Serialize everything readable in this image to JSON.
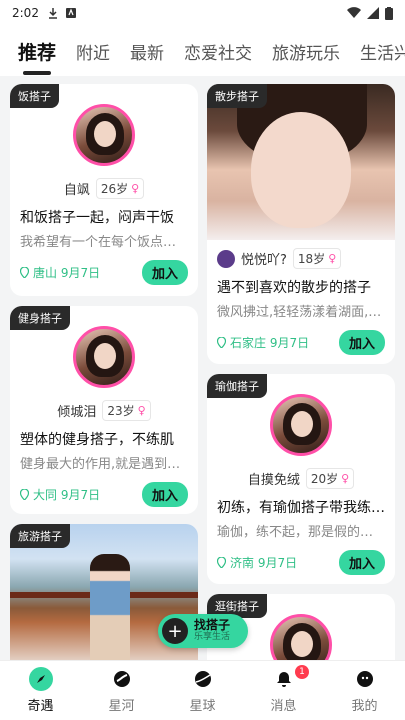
{
  "status": {
    "time": "2:02"
  },
  "tabs": [
    {
      "label": "推荐"
    },
    {
      "label": "附近"
    },
    {
      "label": "最新"
    },
    {
      "label": "恋爱社交"
    },
    {
      "label": "旅游玩乐"
    },
    {
      "label": "生活兴趣"
    }
  ],
  "cards": {
    "c1": {
      "tag": "饭搭子",
      "name": "自飒",
      "age": "26岁",
      "title": "和饭搭子一起，闷声干饭",
      "desc": "我希望有一个在每个饭点…",
      "location": "唐山 9月7日",
      "join": "加入"
    },
    "c2": {
      "tag": "散步搭子",
      "name": "悦悦吖?",
      "age": "18岁",
      "title": "遇不到喜欢的散步的搭子",
      "desc": "微风拂过,轻轻荡漾着湖面,…",
      "location": "石家庄 9月7日",
      "join": "加入"
    },
    "c3": {
      "tag": "健身搭子",
      "name": "倾城泪",
      "age": "23岁",
      "title": "塑体的健身搭子，不练肌",
      "desc": "健身最大的作用,就是遇到…",
      "location": "大同 9月7日",
      "join": "加入"
    },
    "c4": {
      "tag": "瑜伽搭子",
      "name": "自摸免绒",
      "age": "20岁",
      "title": "初练，有瑜伽搭子带我练…",
      "desc": "瑜伽，练不起，那是假的…",
      "location": "济南 9月7日",
      "join": "加入"
    },
    "c5": {
      "tag": "旅游搭子"
    },
    "c6": {
      "tag": "逛街搭子"
    }
  },
  "fab": {
    "title": "找搭子",
    "subtitle": "乐享生活"
  },
  "nav": [
    {
      "label": "奇遇",
      "icon": "compass-icon"
    },
    {
      "label": "星河",
      "icon": "galaxy-icon"
    },
    {
      "label": "星球",
      "icon": "planet-icon"
    },
    {
      "label": "消息",
      "icon": "bell-icon",
      "badge": "1"
    },
    {
      "label": "我的",
      "icon": "profile-icon"
    }
  ],
  "colors": {
    "accent": "#35d6a0",
    "pink": "#ff4fa8",
    "badge": "#ff3b4e"
  }
}
